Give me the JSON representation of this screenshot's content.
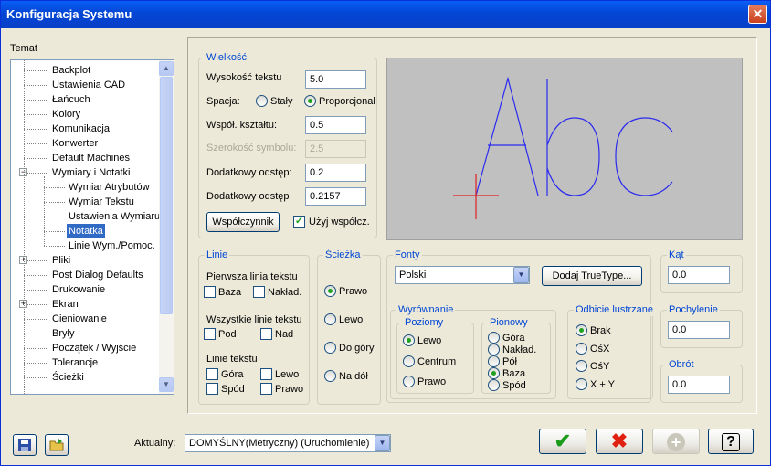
{
  "window": {
    "title": "Konfiguracja Systemu"
  },
  "icons": {
    "close": "close-icon",
    "ok": "check-icon",
    "cancel": "x-icon",
    "add": "plus-icon",
    "help": "question-icon",
    "save": "save-icon",
    "open": "open-folder-icon"
  },
  "tree": {
    "label": "Temat",
    "items": [
      {
        "label": "Backplot",
        "level": 1
      },
      {
        "label": "Ustawienia CAD",
        "level": 1
      },
      {
        "label": "Łańcuch",
        "level": 1
      },
      {
        "label": "Kolory",
        "level": 1
      },
      {
        "label": "Komunikacja",
        "level": 1
      },
      {
        "label": "Konwerter",
        "level": 1
      },
      {
        "label": "Default Machines",
        "level": 1
      },
      {
        "label": "Wymiary i Notatki",
        "level": 1,
        "expander": "−"
      },
      {
        "label": "Wymiar Atrybutów",
        "level": 2
      },
      {
        "label": "Wymiar Tekstu",
        "level": 2
      },
      {
        "label": "Ustawienia Wymiaru",
        "level": 2
      },
      {
        "label": "Notatka",
        "level": 2,
        "selected": true
      },
      {
        "label": "Linie Wym./Pomoc.",
        "level": 2
      },
      {
        "label": "Pliki",
        "level": 1,
        "expander": "+"
      },
      {
        "label": "Post Dialog Defaults",
        "level": 1
      },
      {
        "label": "Drukowanie",
        "level": 1
      },
      {
        "label": "Ekran",
        "level": 1,
        "expander": "+"
      },
      {
        "label": "Cieniowanie",
        "level": 1
      },
      {
        "label": "Bryły",
        "level": 1
      },
      {
        "label": "Początek / Wyjście",
        "level": 1
      },
      {
        "label": "Tolerancje",
        "level": 1
      },
      {
        "label": "Ścieżki",
        "level": 1
      }
    ]
  },
  "wielkosc": {
    "legend": "Wielkość",
    "text_height_label": "Wysokość tekstu",
    "text_height": "5.0",
    "spacing_label": "Spacja:",
    "spacing_fixed": "Stały",
    "spacing_prop": "Proporcjonal",
    "aspect_label": "Współ. kształtu:",
    "aspect": "0.5",
    "symbol_width_label": "Szerokość symbolu:",
    "symbol_width": "2.5",
    "extra_gap1_label": "Dodatkowy odstęp:",
    "extra_gap1": "0.2",
    "extra_gap2_label": "Dodatkowy odstęp",
    "extra_gap2": "0.2157",
    "factor_button": "Współczynnik",
    "use_factor_label": "Użyj współcz."
  },
  "preview": {
    "text": "Abc"
  },
  "linie": {
    "legend": "Linie",
    "first_line_label": "Pierwsza linia tekstu",
    "baza": "Baza",
    "naklad": "Nakład.",
    "all_lines_label": "Wszystkie linie tekstu",
    "pod": "Pod",
    "nad": "Nad",
    "text_lines_label": "Linie tekstu",
    "gora": "Góra",
    "lewo": "Lewo",
    "spod": "Spód",
    "prawo": "Prawo"
  },
  "sciezka": {
    "legend": "Ścieżka",
    "prawo": "Prawo",
    "lewo": "Lewo",
    "do_gory": "Do góry",
    "na_dol": "Na dół"
  },
  "fonty": {
    "legend": "Fonty",
    "selected": "Polski",
    "add_truetype": "Dodaj TrueType..."
  },
  "wyrownanie": {
    "legend": "Wyrównanie",
    "poziomy_legend": "Poziomy",
    "lewo": "Lewo",
    "centrum": "Centrum",
    "prawo": "Prawo",
    "pionowy_legend": "Pionowy",
    "gora": "Góra",
    "naklad": "Nakład.",
    "pol": "Pół",
    "baza": "Baza",
    "spod": "Spód"
  },
  "odbicie": {
    "legend": "Odbicie lustrzane",
    "brak": "Brak",
    "osx": "OśX",
    "osy": "OśY",
    "xy": "X + Y"
  },
  "kat": {
    "legend": "Kąt",
    "value": "0.0"
  },
  "pochylenie": {
    "legend": "Pochylenie",
    "value": "0.0"
  },
  "obrot": {
    "legend": "Obrót",
    "value": "0.0"
  },
  "footer": {
    "current_label": "Aktualny:",
    "current_value": "DOMYŚLNY(Metryczny) (Uruchomienie)"
  },
  "colors": {
    "ok": "#1a9b1a",
    "cancel": "#e02010",
    "selection": "#316ac5",
    "preview_bg": "#c0c0c0",
    "preview_glyph": "#2a2af0",
    "cursor": "#e02020"
  }
}
